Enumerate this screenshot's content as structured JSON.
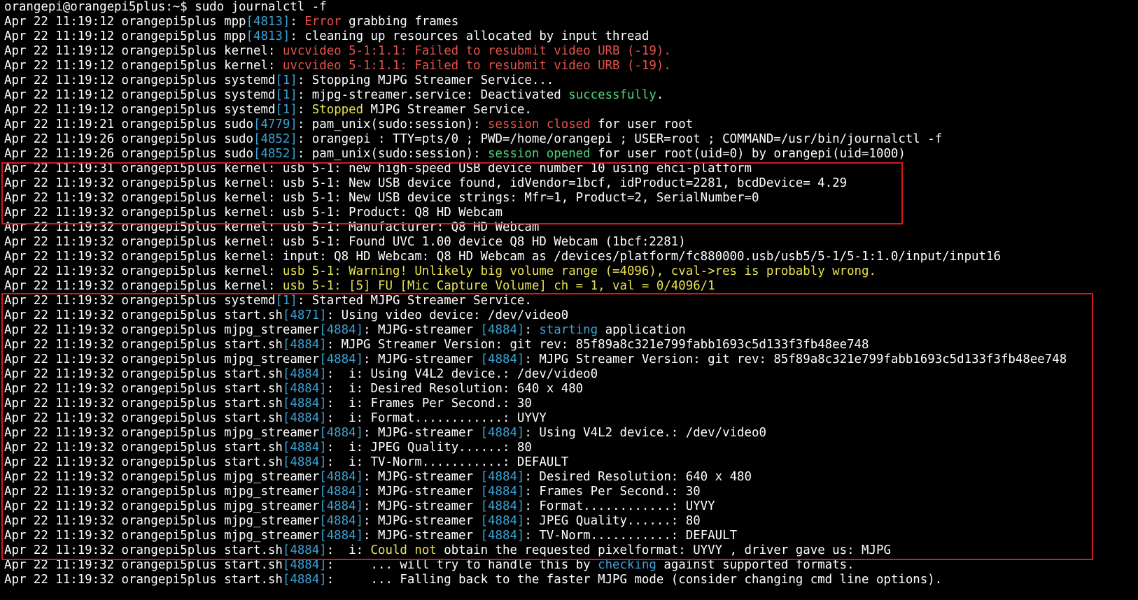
{
  "terminal": {
    "prompt": "orangepi@orangepi5plus:~$ sudo journalctl -f",
    "lines": [
      [
        [
          "Apr 22 11:19:12 orangepi5plus mpp",
          "n"
        ],
        [
          "[4813]",
          "pid"
        ],
        [
          ": ",
          "n"
        ],
        [
          "Error",
          "red"
        ],
        [
          " grabbing frames",
          "n"
        ]
      ],
      [
        [
          "Apr 22 11:19:12 orangepi5plus mpp",
          "n"
        ],
        [
          "[4813]",
          "pid"
        ],
        [
          ": cleaning up resources allocated by input thread",
          "n"
        ]
      ],
      [
        [
          "Apr 22 11:19:12 orangepi5plus kernel: ",
          "n"
        ],
        [
          "uvcvideo 5-1:1.1: Failed to resubmit video URB (-19).",
          "red"
        ]
      ],
      [
        [
          "Apr 22 11:19:12 orangepi5plus kernel: ",
          "n"
        ],
        [
          "uvcvideo 5-1:1.1: Failed to resubmit video URB (-19).",
          "red"
        ]
      ],
      [
        [
          "Apr 22 11:19:12 orangepi5plus systemd",
          "n"
        ],
        [
          "[1]",
          "pid"
        ],
        [
          ": Stopping MJPG Streamer Service...",
          "n"
        ]
      ],
      [
        [
          "Apr 22 11:19:12 orangepi5plus systemd",
          "n"
        ],
        [
          "[1]",
          "pid"
        ],
        [
          ": mjpg-streamer.service: Deactivated ",
          "n"
        ],
        [
          "successfully",
          "green"
        ],
        [
          ".",
          "n"
        ]
      ],
      [
        [
          "Apr 22 11:19:12 orangepi5plus systemd",
          "n"
        ],
        [
          "[1]",
          "pid"
        ],
        [
          ": ",
          "n"
        ],
        [
          "Stopped",
          "yellow"
        ],
        [
          " MJPG Streamer Service.",
          "n"
        ]
      ],
      [
        [
          "Apr 22 11:19:21 orangepi5plus sudo",
          "n"
        ],
        [
          "[4779]",
          "pid"
        ],
        [
          ": pam_unix(sudo:session): ",
          "n"
        ],
        [
          "session closed",
          "red"
        ],
        [
          " for user root",
          "n"
        ]
      ],
      [
        [
          "Apr 22 11:19:26 orangepi5plus sudo",
          "n"
        ],
        [
          "[4852]",
          "pid"
        ],
        [
          ": orangepi : TTY=pts/0 ; PWD=/home/orangepi ; USER=root ; COMMAND=/usr/bin/journalctl -f",
          "n"
        ]
      ],
      [
        [
          "Apr 22 11:19:26 orangepi5plus sudo",
          "n"
        ],
        [
          "[4852]",
          "pid"
        ],
        [
          ": pam_unix(sudo:session): ",
          "n"
        ],
        [
          "session opened",
          "green"
        ],
        [
          " for user root(uid=0) by orangepi(uid=1000)",
          "n"
        ]
      ],
      [
        [
          "Apr 22 11:19:31 orangepi5plus kernel: usb 5-1: new high-speed USB device number 10 using ehci-platform",
          "n"
        ]
      ],
      [
        [
          "Apr 22 11:19:32 orangepi5plus kernel: usb 5-1: New USB device found, idVendor=1bcf, idProduct=2281, bcdDevice= 4.29",
          "n"
        ]
      ],
      [
        [
          "Apr 22 11:19:32 orangepi5plus kernel: usb 5-1: New USB device strings: Mfr=1, Product=2, SerialNumber=0",
          "n"
        ]
      ],
      [
        [
          "Apr 22 11:19:32 orangepi5plus kernel: usb 5-1: Product: Q8 HD Webcam",
          "n"
        ]
      ],
      [
        [
          "Apr 22 11:19:32 orangepi5plus kernel: usb 5-1: Manufacturer: Q8 HD Webcam",
          "n"
        ]
      ],
      [
        [
          "Apr 22 11:19:32 orangepi5plus kernel: usb 5-1: Found UVC 1.00 device Q8 HD Webcam (1bcf:2281)",
          "n"
        ]
      ],
      [
        [
          "Apr 22 11:19:32 orangepi5plus kernel: input: Q8 HD Webcam: Q8 HD Webcam as /devices/platform/fc880000.usb/usb5/5-1/5-1:1.0/input/input16",
          "n"
        ]
      ],
      [
        [
          "Apr 22 11:19:32 orangepi5plus kernel: ",
          "n"
        ],
        [
          "usb 5-1: Warning! Unlikely big volume range (=4096), cval->res is probably wrong.",
          "yellow"
        ]
      ],
      [
        [
          "Apr 22 11:19:32 orangepi5plus kernel: ",
          "n"
        ],
        [
          "usb 5-1: [5] FU [Mic Capture Volume] ch = 1, val = 0/4096/1",
          "yellow"
        ]
      ],
      [
        [
          "Apr 22 11:19:32 orangepi5plus systemd",
          "n"
        ],
        [
          "[1]",
          "pid"
        ],
        [
          ": Started MJPG Streamer Service.",
          "n"
        ]
      ],
      [
        [
          "Apr 22 11:19:32 orangepi5plus start.sh",
          "n"
        ],
        [
          "[4871]",
          "pid"
        ],
        [
          ": Using video device: /dev/video0",
          "n"
        ]
      ],
      [
        [
          "Apr 22 11:19:32 orangepi5plus mjpg_streamer",
          "n"
        ],
        [
          "[4884]",
          "pid"
        ],
        [
          ": MJPG-streamer ",
          "n"
        ],
        [
          "[4884]",
          "pid"
        ],
        [
          ": ",
          "n"
        ],
        [
          "starting",
          "blue"
        ],
        [
          " application",
          "n"
        ]
      ],
      [
        [
          "Apr 22 11:19:32 orangepi5plus start.sh",
          "n"
        ],
        [
          "[4884]",
          "pid"
        ],
        [
          ": MJPG Streamer Version: git rev: 85f89a8c321e799fabb1693c5d133f3fb48ee748",
          "n"
        ]
      ],
      [
        [
          "Apr 22 11:19:32 orangepi5plus mjpg_streamer",
          "n"
        ],
        [
          "[4884]",
          "pid"
        ],
        [
          ": MJPG-streamer ",
          "n"
        ],
        [
          "[4884]",
          "pid"
        ],
        [
          ": MJPG Streamer Version: git rev: 85f89a8c321e799fabb1693c5d133f3fb48ee748",
          "n"
        ]
      ],
      [
        [
          "Apr 22 11:19:32 orangepi5plus start.sh",
          "n"
        ],
        [
          "[4884]",
          "pid"
        ],
        [
          ":  i: Using V4L2 device.: /dev/video0",
          "n"
        ]
      ],
      [
        [
          "Apr 22 11:19:32 orangepi5plus start.sh",
          "n"
        ],
        [
          "[4884]",
          "pid"
        ],
        [
          ":  i: Desired Resolution: 640 x 480",
          "n"
        ]
      ],
      [
        [
          "Apr 22 11:19:32 orangepi5plus start.sh",
          "n"
        ],
        [
          "[4884]",
          "pid"
        ],
        [
          ":  i: Frames Per Second.: 30",
          "n"
        ]
      ],
      [
        [
          "Apr 22 11:19:32 orangepi5plus start.sh",
          "n"
        ],
        [
          "[4884]",
          "pid"
        ],
        [
          ":  i: Format............: UYVY",
          "n"
        ]
      ],
      [
        [
          "Apr 22 11:19:32 orangepi5plus mjpg_streamer",
          "n"
        ],
        [
          "[4884]",
          "pid"
        ],
        [
          ": MJPG-streamer ",
          "n"
        ],
        [
          "[4884]",
          "pid"
        ],
        [
          ": Using V4L2 device.: /dev/video0",
          "n"
        ]
      ],
      [
        [
          "Apr 22 11:19:32 orangepi5plus start.sh",
          "n"
        ],
        [
          "[4884]",
          "pid"
        ],
        [
          ":  i: JPEG Quality......: 80",
          "n"
        ]
      ],
      [
        [
          "Apr 22 11:19:32 orangepi5plus start.sh",
          "n"
        ],
        [
          "[4884]",
          "pid"
        ],
        [
          ":  i: TV-Norm...........: DEFAULT",
          "n"
        ]
      ],
      [
        [
          "Apr 22 11:19:32 orangepi5plus mjpg_streamer",
          "n"
        ],
        [
          "[4884]",
          "pid"
        ],
        [
          ": MJPG-streamer ",
          "n"
        ],
        [
          "[4884]",
          "pid"
        ],
        [
          ": Desired Resolution: 640 x 480",
          "n"
        ]
      ],
      [
        [
          "Apr 22 11:19:32 orangepi5plus mjpg_streamer",
          "n"
        ],
        [
          "[4884]",
          "pid"
        ],
        [
          ": MJPG-streamer ",
          "n"
        ],
        [
          "[4884]",
          "pid"
        ],
        [
          ": Frames Per Second.: 30",
          "n"
        ]
      ],
      [
        [
          "Apr 22 11:19:32 orangepi5plus mjpg_streamer",
          "n"
        ],
        [
          "[4884]",
          "pid"
        ],
        [
          ": MJPG-streamer ",
          "n"
        ],
        [
          "[4884]",
          "pid"
        ],
        [
          ": Format............: UYVY",
          "n"
        ]
      ],
      [
        [
          "Apr 22 11:19:32 orangepi5plus mjpg_streamer",
          "n"
        ],
        [
          "[4884]",
          "pid"
        ],
        [
          ": MJPG-streamer ",
          "n"
        ],
        [
          "[4884]",
          "pid"
        ],
        [
          ": JPEG Quality......: 80",
          "n"
        ]
      ],
      [
        [
          "Apr 22 11:19:32 orangepi5plus mjpg_streamer",
          "n"
        ],
        [
          "[4884]",
          "pid"
        ],
        [
          ": MJPG-streamer ",
          "n"
        ],
        [
          "[4884]",
          "pid"
        ],
        [
          ": TV-Norm...........: DEFAULT",
          "n"
        ]
      ],
      [
        [
          "Apr 22 11:19:32 orangepi5plus start.sh",
          "n"
        ],
        [
          "[4884]",
          "pid"
        ],
        [
          ":  i: ",
          "n"
        ],
        [
          "Could not",
          "yellow"
        ],
        [
          " obtain the requested pixelformat: UYVY , driver gave us: MJPG",
          "n"
        ]
      ],
      [
        [
          "Apr 22 11:19:32 orangepi5plus start.sh",
          "n"
        ],
        [
          "[4884]",
          "pid"
        ],
        [
          ":     ... will try to handle this by ",
          "n"
        ],
        [
          "checking",
          "blue"
        ],
        [
          " against supported formats.",
          "n"
        ]
      ],
      [
        [
          "Apr 22 11:19:32 orangepi5plus start.sh",
          "n"
        ],
        [
          "[4884]",
          "pid"
        ],
        [
          ":     ... Falling back to the faster MJPG mode (consider changing cmd line options).",
          "n"
        ]
      ]
    ]
  },
  "colors": {
    "background": "#000000",
    "text": "#ffffff",
    "pid": "#3ba3d6",
    "red": "#e5534b",
    "green": "#4fd57b",
    "yellow": "#e9e34f",
    "highlight_box": "#d61a1a"
  }
}
